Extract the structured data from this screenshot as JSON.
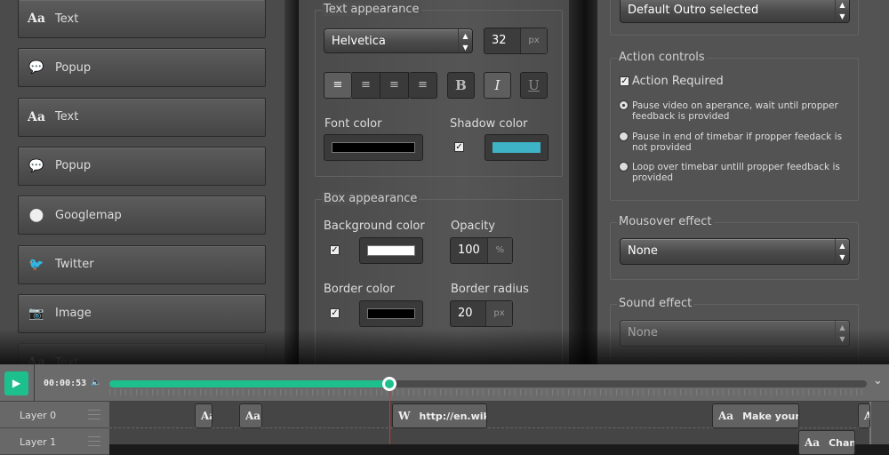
{
  "sidebar": {
    "items": [
      {
        "icon": "text-icon",
        "glyph": "Aa",
        "label": "Text"
      },
      {
        "icon": "popup-icon",
        "glyph": "💬",
        "label": "Popup"
      },
      {
        "icon": "text-icon",
        "glyph": "Aa",
        "label": "Text"
      },
      {
        "icon": "popup-icon",
        "glyph": "💬",
        "label": "Popup"
      },
      {
        "icon": "map-pin-icon",
        "glyph": "⬤",
        "label": "Googlemap"
      },
      {
        "icon": "twitter-icon",
        "glyph": "🐦",
        "label": "Twitter"
      },
      {
        "icon": "camera-icon",
        "glyph": "📷",
        "label": "Image"
      },
      {
        "icon": "text-icon",
        "glyph": "Aa",
        "label": "Text"
      }
    ]
  },
  "text_appearance": {
    "legend": "Text appearance",
    "font": "Helvetica",
    "size": "32",
    "size_unit": "px",
    "align": [
      "left",
      "center",
      "right",
      "justify"
    ],
    "bold": "B",
    "italic": "I",
    "underline": "U",
    "font_color_label": "Font color",
    "font_color": "#000000",
    "shadow_color_label": "Shadow color",
    "shadow_enabled": true,
    "shadow_color": "#3fb3c6"
  },
  "box_appearance": {
    "legend": "Box appearance",
    "bg_label": "Background color",
    "bg_enabled": true,
    "bg_color": "#ffffff",
    "opacity_label": "Opacity",
    "opacity": "100",
    "opacity_unit": "%",
    "border_label": "Border color",
    "border_enabled": true,
    "border_color": "#000000",
    "radius_label": "Border radius",
    "radius": "20",
    "radius_unit": "px"
  },
  "right": {
    "outro": "Default Outro selected",
    "action_legend": "Action controls",
    "action_required": "Action Required",
    "options": [
      {
        "label": "Pause video on aperance, wait until propper feedback is provided",
        "selected": true
      },
      {
        "label": "Pause in end of timebar if propper feedack is not provided",
        "selected": false
      },
      {
        "label": "Loop over timebar untill propper feedback is provided",
        "selected": false
      }
    ],
    "mouseover_label": "Mousover effect",
    "mouseover": "None",
    "sound_label": "Sound effect",
    "sound": "None"
  },
  "timeline": {
    "time": "00:00:53",
    "progress_percent": 37,
    "accent": "#1dbf8c",
    "layers": [
      "Layer 0",
      "Layer 1"
    ],
    "clips": [
      {
        "icon": "Aa",
        "text": ""
      },
      {
        "icon": "Aa",
        "text": ""
      },
      {
        "icon": "W",
        "text": "http://en.wiki"
      },
      {
        "icon": "Aa",
        "text": "Make your"
      },
      {
        "icon": "Aa",
        "text": ""
      },
      {
        "icon": "Aa",
        "text": "Chan"
      }
    ]
  }
}
